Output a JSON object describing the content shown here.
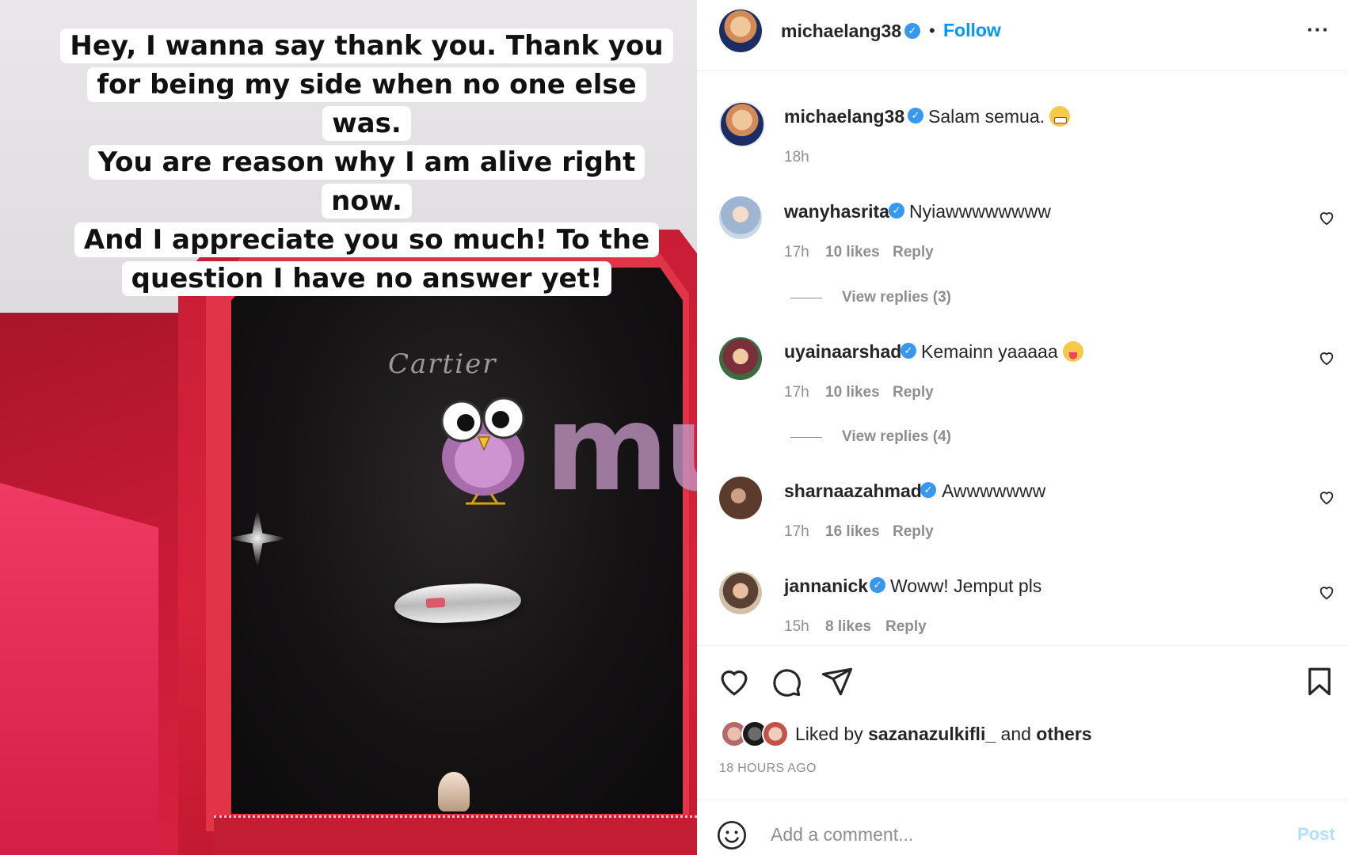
{
  "story": {
    "lines": [
      "Hey, I wanna say thank you. Thank you",
      "for being my side when no one else was.",
      "You are reason why I am alive right now.",
      "And I appreciate you so much! To the",
      "question I have no answer yet!"
    ],
    "brand_script": "Cartier",
    "watermark": "murai"
  },
  "header": {
    "username": "michaelang38",
    "separator": "•",
    "follow_label": "Follow",
    "more_label": "···"
  },
  "caption": {
    "username": "michaelang38",
    "text": "Salam semua.",
    "emoji": "grimacing-face",
    "time": "18h"
  },
  "comments": [
    {
      "username": "wanyhasrita",
      "text": "Nyiawwwwwwww",
      "time": "17h",
      "likes": "10 likes",
      "reply": "Reply",
      "view_replies": "View replies (3)"
    },
    {
      "username": "uyainaarshad",
      "text": "Kemainn yaaaaa",
      "emoji": "tongue-face",
      "time": "17h",
      "likes": "10 likes",
      "reply": "Reply",
      "view_replies": "View replies (4)"
    },
    {
      "username": "sharnaazahmad",
      "text": "Awwwwwww",
      "time": "17h",
      "likes": "16 likes",
      "reply": "Reply"
    },
    {
      "username": "jannanick",
      "text": "Woww! Jemput pls",
      "time": "15h",
      "likes": "8 likes",
      "reply": "Reply"
    }
  ],
  "actions": {
    "icons": [
      "heart-icon",
      "comment-icon",
      "share-icon",
      "bookmark-icon"
    ]
  },
  "likes": {
    "prefix": "Liked by",
    "user": "sazanazulkifli_",
    "and": "and",
    "others": "others"
  },
  "posted": "18 HOURS AGO",
  "comment_box": {
    "placeholder": "Add a comment...",
    "post_label": "Post"
  },
  "colors": {
    "accent": "#0095f6",
    "verified": "#3897f0",
    "muted": "#8e8e8e",
    "post_disabled": "#b2dffc"
  }
}
